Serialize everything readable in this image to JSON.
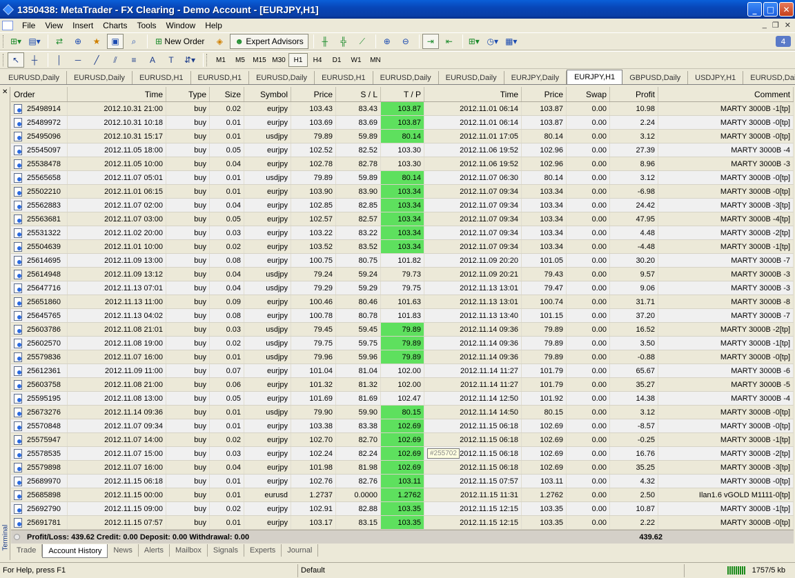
{
  "window": {
    "title": "1350438: MetaTrader - FX Clearing - Demo Account - [EURJPY,H1]"
  },
  "menu": [
    "File",
    "View",
    "Insert",
    "Charts",
    "Tools",
    "Window",
    "Help"
  ],
  "toolbar": {
    "new_order": "New Order",
    "expert_advisors": "Expert Advisors",
    "badge": "4"
  },
  "periods": [
    "M1",
    "M5",
    "M15",
    "M30",
    "H1",
    "H4",
    "D1",
    "W1",
    "MN"
  ],
  "active_period": "H1",
  "chart_tabs": [
    "EURUSD,Daily",
    "EURUSD,Daily",
    "EURUSD,H1",
    "EURUSD,H1",
    "EURUSD,Daily",
    "EURUSD,H1",
    "EURUSD,Daily",
    "EURUSD,Daily",
    "EURJPY,Daily",
    "EURJPY,H1",
    "GBPUSD,Daily",
    "USDJPY,H1",
    "EURUSD,Daily"
  ],
  "active_chart_tab": 9,
  "table": {
    "headers": [
      "Order",
      "Time",
      "Type",
      "Size",
      "Symbol",
      "Price",
      "S / L",
      "T / P",
      "Time",
      "Price",
      "Swap",
      "Profit",
      "Comment"
    ],
    "rows": [
      [
        "25498914",
        "2012.10.31 21:00",
        "buy",
        "0.02",
        "eurjpy",
        "103.43",
        "83.43",
        "103.87",
        "2012.11.01 06:14",
        "103.87",
        "0.00",
        "10.98",
        "MARTY 3000B -1[tp]",
        1
      ],
      [
        "25489972",
        "2012.10.31 10:18",
        "buy",
        "0.01",
        "eurjpy",
        "103.69",
        "83.69",
        "103.87",
        "2012.11.01 06:14",
        "103.87",
        "0.00",
        "2.24",
        "MARTY 3000B -0[tp]",
        1
      ],
      [
        "25495096",
        "2012.10.31 15:17",
        "buy",
        "0.01",
        "usdjpy",
        "79.89",
        "59.89",
        "80.14",
        "2012.11.01 17:05",
        "80.14",
        "0.00",
        "3.12",
        "MARTY 3000B -0[tp]",
        1
      ],
      [
        "25545097",
        "2012.11.05 18:00",
        "buy",
        "0.05",
        "eurjpy",
        "102.52",
        "82.52",
        "103.30",
        "2012.11.06 19:52",
        "102.96",
        "0.00",
        "27.39",
        "MARTY 3000B -4",
        0
      ],
      [
        "25538478",
        "2012.11.05 10:00",
        "buy",
        "0.04",
        "eurjpy",
        "102.78",
        "82.78",
        "103.30",
        "2012.11.06 19:52",
        "102.96",
        "0.00",
        "8.96",
        "MARTY 3000B -3",
        0
      ],
      [
        "25565658",
        "2012.11.07 05:01",
        "buy",
        "0.01",
        "usdjpy",
        "79.89",
        "59.89",
        "80.14",
        "2012.11.07 06:30",
        "80.14",
        "0.00",
        "3.12",
        "MARTY 3000B -0[tp]",
        1
      ],
      [
        "25502210",
        "2012.11.01 06:15",
        "buy",
        "0.01",
        "eurjpy",
        "103.90",
        "83.90",
        "103.34",
        "2012.11.07 09:34",
        "103.34",
        "0.00",
        "-6.98",
        "MARTY 3000B -0[tp]",
        1
      ],
      [
        "25562883",
        "2012.11.07 02:00",
        "buy",
        "0.04",
        "eurjpy",
        "102.85",
        "82.85",
        "103.34",
        "2012.11.07 09:34",
        "103.34",
        "0.00",
        "24.42",
        "MARTY 3000B -3[tp]",
        1
      ],
      [
        "25563681",
        "2012.11.07 03:00",
        "buy",
        "0.05",
        "eurjpy",
        "102.57",
        "82.57",
        "103.34",
        "2012.11.07 09:34",
        "103.34",
        "0.00",
        "47.95",
        "MARTY 3000B -4[tp]",
        1
      ],
      [
        "25531322",
        "2012.11.02 20:00",
        "buy",
        "0.03",
        "eurjpy",
        "103.22",
        "83.22",
        "103.34",
        "2012.11.07 09:34",
        "103.34",
        "0.00",
        "4.48",
        "MARTY 3000B -2[tp]",
        1
      ],
      [
        "25504639",
        "2012.11.01 10:00",
        "buy",
        "0.02",
        "eurjpy",
        "103.52",
        "83.52",
        "103.34",
        "2012.11.07 09:34",
        "103.34",
        "0.00",
        "-4.48",
        "MARTY 3000B -1[tp]",
        1
      ],
      [
        "25614695",
        "2012.11.09 13:00",
        "buy",
        "0.08",
        "eurjpy",
        "100.75",
        "80.75",
        "101.82",
        "2012.11.09 20:20",
        "101.05",
        "0.00",
        "30.20",
        "MARTY 3000B -7",
        0
      ],
      [
        "25614948",
        "2012.11.09 13:12",
        "buy",
        "0.04",
        "usdjpy",
        "79.24",
        "59.24",
        "79.73",
        "2012.11.09 20:21",
        "79.43",
        "0.00",
        "9.57",
        "MARTY 3000B -3",
        0
      ],
      [
        "25647716",
        "2012.11.13 07:01",
        "buy",
        "0.04",
        "usdjpy",
        "79.29",
        "59.29",
        "79.75",
        "2012.11.13 13:01",
        "79.47",
        "0.00",
        "9.06",
        "MARTY 3000B -3",
        0
      ],
      [
        "25651860",
        "2012.11.13 11:00",
        "buy",
        "0.09",
        "eurjpy",
        "100.46",
        "80.46",
        "101.63",
        "2012.11.13 13:01",
        "100.74",
        "0.00",
        "31.71",
        "MARTY 3000B -8",
        0
      ],
      [
        "25645765",
        "2012.11.13 04:02",
        "buy",
        "0.08",
        "eurjpy",
        "100.78",
        "80.78",
        "101.83",
        "2012.11.13 13:40",
        "101.15",
        "0.00",
        "37.20",
        "MARTY 3000B -7",
        0
      ],
      [
        "25603786",
        "2012.11.08 21:01",
        "buy",
        "0.03",
        "usdjpy",
        "79.45",
        "59.45",
        "79.89",
        "2012.11.14 09:36",
        "79.89",
        "0.00",
        "16.52",
        "MARTY 3000B -2[tp]",
        1
      ],
      [
        "25602570",
        "2012.11.08 19:00",
        "buy",
        "0.02",
        "usdjpy",
        "79.75",
        "59.75",
        "79.89",
        "2012.11.14 09:36",
        "79.89",
        "0.00",
        "3.50",
        "MARTY 3000B -1[tp]",
        1
      ],
      [
        "25579836",
        "2012.11.07 16:00",
        "buy",
        "0.01",
        "usdjpy",
        "79.96",
        "59.96",
        "79.89",
        "2012.11.14 09:36",
        "79.89",
        "0.00",
        "-0.88",
        "MARTY 3000B -0[tp]",
        1
      ],
      [
        "25612361",
        "2012.11.09 11:00",
        "buy",
        "0.07",
        "eurjpy",
        "101.04",
        "81.04",
        "102.00",
        "2012.11.14 11:27",
        "101.79",
        "0.00",
        "65.67",
        "MARTY 3000B -6",
        0
      ],
      [
        "25603758",
        "2012.11.08 21:00",
        "buy",
        "0.06",
        "eurjpy",
        "101.32",
        "81.32",
        "102.00",
        "2012.11.14 11:27",
        "101.79",
        "0.00",
        "35.27",
        "MARTY 3000B -5",
        0
      ],
      [
        "25595195",
        "2012.11.08 13:00",
        "buy",
        "0.05",
        "eurjpy",
        "101.69",
        "81.69",
        "102.47",
        "2012.11.14 12:50",
        "101.92",
        "0.00",
        "14.38",
        "MARTY 3000B -4",
        0
      ],
      [
        "25673276",
        "2012.11.14 09:36",
        "buy",
        "0.01",
        "usdjpy",
        "79.90",
        "59.90",
        "80.15",
        "2012.11.14 14:50",
        "80.15",
        "0.00",
        "3.12",
        "MARTY 3000B -0[tp]",
        1
      ],
      [
        "25570848",
        "2012.11.07 09:34",
        "buy",
        "0.01",
        "eurjpy",
        "103.38",
        "83.38",
        "102.69",
        "2012.11.15 06:18",
        "102.69",
        "0.00",
        "-8.57",
        "MARTY 3000B -0[tp]",
        1
      ],
      [
        "25575947",
        "2012.11.07 14:00",
        "buy",
        "0.02",
        "eurjpy",
        "102.70",
        "82.70",
        "102.69",
        "2012.11.15 06:18",
        "102.69",
        "0.00",
        "-0.25",
        "MARTY 3000B -1[tp]",
        1
      ],
      [
        "25578535",
        "2012.11.07 15:00",
        "buy",
        "0.03",
        "eurjpy",
        "102.24",
        "82.24",
        "102.69",
        "2012.11.15 06:18",
        "102.69",
        "0.00",
        "16.76",
        "MARTY 3000B -2[tp]",
        1
      ],
      [
        "25579898",
        "2012.11.07 16:00",
        "buy",
        "0.04",
        "eurjpy",
        "101.98",
        "81.98",
        "102.69",
        "2012.11.15 06:18",
        "102.69",
        "0.00",
        "35.25",
        "MARTY 3000B -3[tp]",
        1
      ],
      [
        "25689970",
        "2012.11.15 06:18",
        "buy",
        "0.01",
        "eurjpy",
        "102.76",
        "82.76",
        "103.11",
        "2012.11.15 07:57",
        "103.11",
        "0.00",
        "4.32",
        "MARTY 3000B -0[tp]",
        1
      ],
      [
        "25685898",
        "2012.11.15 00:00",
        "buy",
        "0.01",
        "eurusd",
        "1.2737",
        "0.0000",
        "1.2762",
        "2012.11.15 11:31",
        "1.2762",
        "0.00",
        "2.50",
        "Ilan1.6 vGOLD M1111-0[tp]",
        1
      ],
      [
        "25692790",
        "2012.11.15 09:00",
        "buy",
        "0.02",
        "eurjpy",
        "102.91",
        "82.88",
        "103.35",
        "2012.11.15 12:15",
        "103.35",
        "0.00",
        "10.87",
        "MARTY 3000B -1[tp]",
        1
      ],
      [
        "25691781",
        "2012.11.15 07:57",
        "buy",
        "0.01",
        "eurjpy",
        "103.17",
        "83.15",
        "103.35",
        "2012.11.15 12:15",
        "103.35",
        "0.00",
        "2.22",
        "MARTY 3000B -0[tp]",
        1
      ]
    ]
  },
  "summary": {
    "text": "Profit/Loss: 439.62  Credit: 0.00  Deposit: 0.00  Withdrawal: 0.00",
    "total": "439.62"
  },
  "tooltip": "#255702",
  "terminal_label": "Terminal",
  "bottom_tabs": [
    "Trade",
    "Account History",
    "News",
    "Alerts",
    "Mailbox",
    "Signals",
    "Experts",
    "Journal"
  ],
  "active_bottom_tab": 1,
  "status": {
    "help": "For Help, press F1",
    "profile": "Default",
    "traffic": "1757/5 kb"
  },
  "colors": {
    "tp_hit": "#5ee05e",
    "title_bar": "#0846b8"
  }
}
